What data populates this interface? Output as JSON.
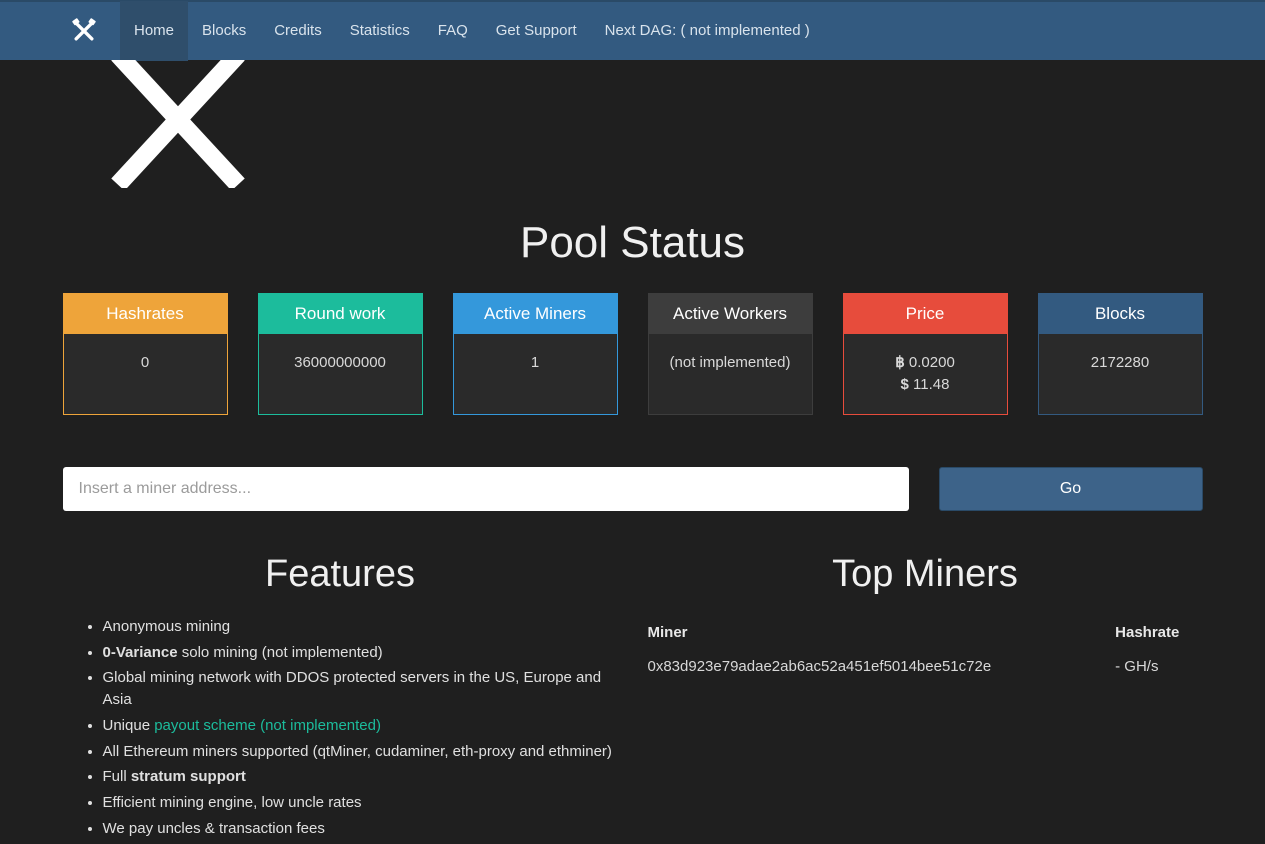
{
  "nav": {
    "items": [
      "Home",
      "Blocks",
      "Credits",
      "Statistics",
      "FAQ",
      "Get Support",
      "Next DAG: ( not implemented )"
    ]
  },
  "title": "Pool Status",
  "stats": {
    "hashrates": {
      "label": "Hashrates",
      "value": "0"
    },
    "round": {
      "label": "Round work",
      "value": "36000000000"
    },
    "miners": {
      "label": "Active Miners",
      "value": "1"
    },
    "workers": {
      "label": "Active Workers",
      "value": "(not implemented)"
    },
    "price": {
      "label": "Price",
      "btc_sym": "฿",
      "btc": "0.0200",
      "usd_sym": "$",
      "usd": "11.48"
    },
    "blocks": {
      "label": "Blocks",
      "value": "2172280"
    }
  },
  "search": {
    "placeholder": "Insert a miner address...",
    "button": "Go"
  },
  "features": {
    "heading": "Features",
    "items": {
      "f0": "Anonymous mining",
      "f1_strong": "0-Variance",
      "f1_rest": " solo mining (not implemented)",
      "f2": "Global mining network with DDOS protected servers in the US, Europe and Asia",
      "f3_pre": "Unique ",
      "f3_link": "payout scheme (not implemented)",
      "f4": "All Ethereum miners supported (qtMiner, cudaminer, eth-proxy and ethminer)",
      "f5_pre": "Full ",
      "f5_strong": "stratum support",
      "f6": "Efficient mining engine, low uncle rates",
      "f7": "We pay uncles & transaction fees"
    }
  },
  "top_miners": {
    "heading": "Top Miners",
    "col1": "Miner",
    "col2": "Hashrate",
    "rows": [
      {
        "miner": "0x83d923e79adae2ab6ac52a451ef5014bee51c72e",
        "hashrate": "- GH/s"
      }
    ]
  }
}
